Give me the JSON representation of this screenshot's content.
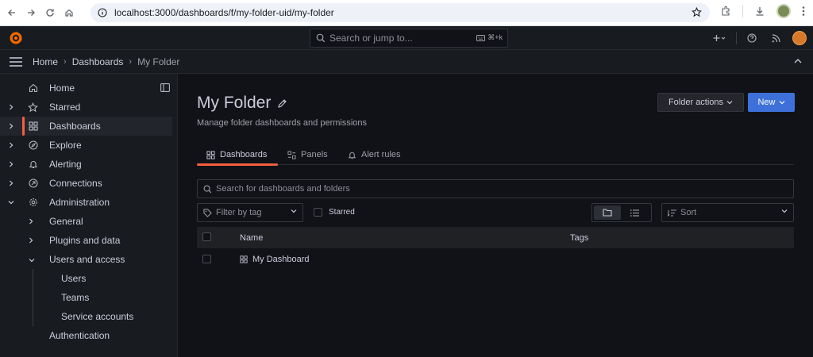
{
  "browser": {
    "url": "localhost:3000/dashboards/f/my-folder-uid/my-folder",
    "icons": [
      "back-icon",
      "forward-icon",
      "reload-icon",
      "home-icon",
      "site-info-icon",
      "bookmark-star-icon",
      "extensions-icon",
      "download-icon",
      "profile-avatar"
    ]
  },
  "topbar": {
    "search_placeholder": "Search or jump to...",
    "shortcut": "⌘+k",
    "icons": [
      "grafana-logo",
      "plus-icon",
      "help-icon",
      "news-icon",
      "user-avatar"
    ]
  },
  "breadcrumb": {
    "items": [
      "Home",
      "Dashboards",
      "My Folder"
    ]
  },
  "sidebar": {
    "items": [
      {
        "label": "Home",
        "icon": "home-icon"
      },
      {
        "label": "Starred",
        "icon": "star-icon"
      },
      {
        "label": "Dashboards",
        "icon": "dashboards-icon",
        "active": true
      },
      {
        "label": "Explore",
        "icon": "compass-icon"
      },
      {
        "label": "Alerting",
        "icon": "bell-icon"
      },
      {
        "label": "Connections",
        "icon": "connections-icon"
      },
      {
        "label": "Administration",
        "icon": "cog-icon"
      }
    ],
    "admin_children": [
      "General",
      "Plugins and data",
      "Users and access"
    ],
    "users_children": [
      "Users",
      "Teams",
      "Service accounts"
    ],
    "last_item": "Authentication"
  },
  "page": {
    "title": "My Folder",
    "subtitle": "Manage folder dashboards and permissions",
    "folder_actions_label": "Folder actions",
    "new_label": "New",
    "tabs": [
      {
        "label": "Dashboards",
        "icon": "dashboards-icon",
        "active": true
      },
      {
        "label": "Panels",
        "icon": "panels-icon"
      },
      {
        "label": "Alert rules",
        "icon": "bell-icon"
      }
    ],
    "search_placeholder": "Search for dashboards and folders",
    "filter_tag_placeholder": "Filter by tag",
    "starred_label": "Starred",
    "sort_label": "Sort",
    "table": {
      "columns": [
        "Name",
        "Tags"
      ],
      "rows": [
        {
          "name": "My Dashboard",
          "tags": ""
        }
      ]
    },
    "colors": {
      "accent": "#f55f3e",
      "primary": "#3d71d9"
    }
  }
}
